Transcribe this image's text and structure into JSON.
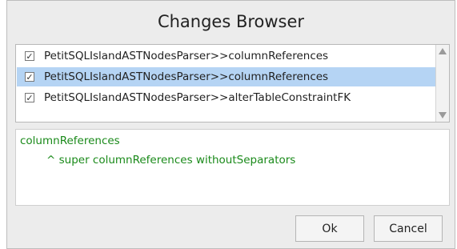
{
  "dialog": {
    "title": "Changes Browser"
  },
  "changes": [
    {
      "label": "PetitSQLIslandASTNodesParser>>columnReferences",
      "checked": true,
      "selected": false
    },
    {
      "label": "PetitSQLIslandASTNodesParser>>columnReferences",
      "checked": true,
      "selected": true
    },
    {
      "label": "PetitSQLIslandASTNodesParser>>alterTableConstraintFK",
      "checked": true,
      "selected": false
    }
  ],
  "checkmark": "✓",
  "code": {
    "line1": "columnReferences",
    "line2": "^ super columnReferences withoutSeparators"
  },
  "buttons": {
    "ok": "Ok",
    "cancel": "Cancel"
  },
  "colors": {
    "selection": "#b5d4f4",
    "code_text": "#1a8a1a"
  }
}
